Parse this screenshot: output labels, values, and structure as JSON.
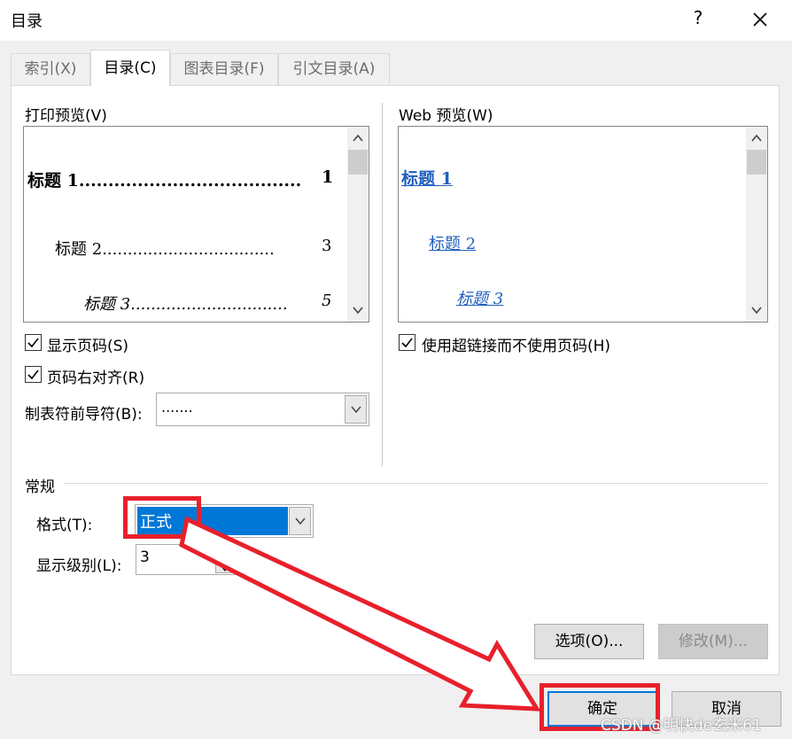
{
  "window": {
    "title": "目录",
    "help": "?"
  },
  "tabs": [
    {
      "label": "索引(X)",
      "active": false
    },
    {
      "label": "目录(C)",
      "active": true
    },
    {
      "label": "图表目录(F)",
      "active": false
    },
    {
      "label": "引文目录(A)",
      "active": false
    }
  ],
  "print_preview": {
    "label": "打印预览(V)",
    "entries": [
      {
        "text": "标题  1",
        "leader": "......................................",
        "page": "1"
      },
      {
        "text": "标题  2",
        "leader": "..................................",
        "page": "3"
      },
      {
        "text": "标题  3",
        "leader": "...............................",
        "page": "5"
      }
    ]
  },
  "web_preview": {
    "label": "Web 预览(W)",
    "entries": [
      "标题 1",
      "标题 2",
      "标题 3"
    ]
  },
  "options": {
    "show_page_numbers": "显示页码(S)",
    "right_align": "页码右对齐(R)",
    "use_hyperlinks": "使用超链接而不使用页码(H)",
    "tab_leader_label": "制表符前导符(B):",
    "tab_leader_value": "......."
  },
  "general": {
    "group_label": "常规",
    "format_label": "格式(T):",
    "format_value": "正式",
    "levels_label": "显示级别(L):",
    "levels_value": "3"
  },
  "buttons": {
    "options": "选项(O)...",
    "modify": "修改(M)...",
    "ok": "确定",
    "cancel": "取消"
  },
  "watermark": "CSDN @明快de玄米61",
  "colors": {
    "selection": "#0078d7",
    "annotation": "#e8202c",
    "link": "#1f5fbf"
  }
}
